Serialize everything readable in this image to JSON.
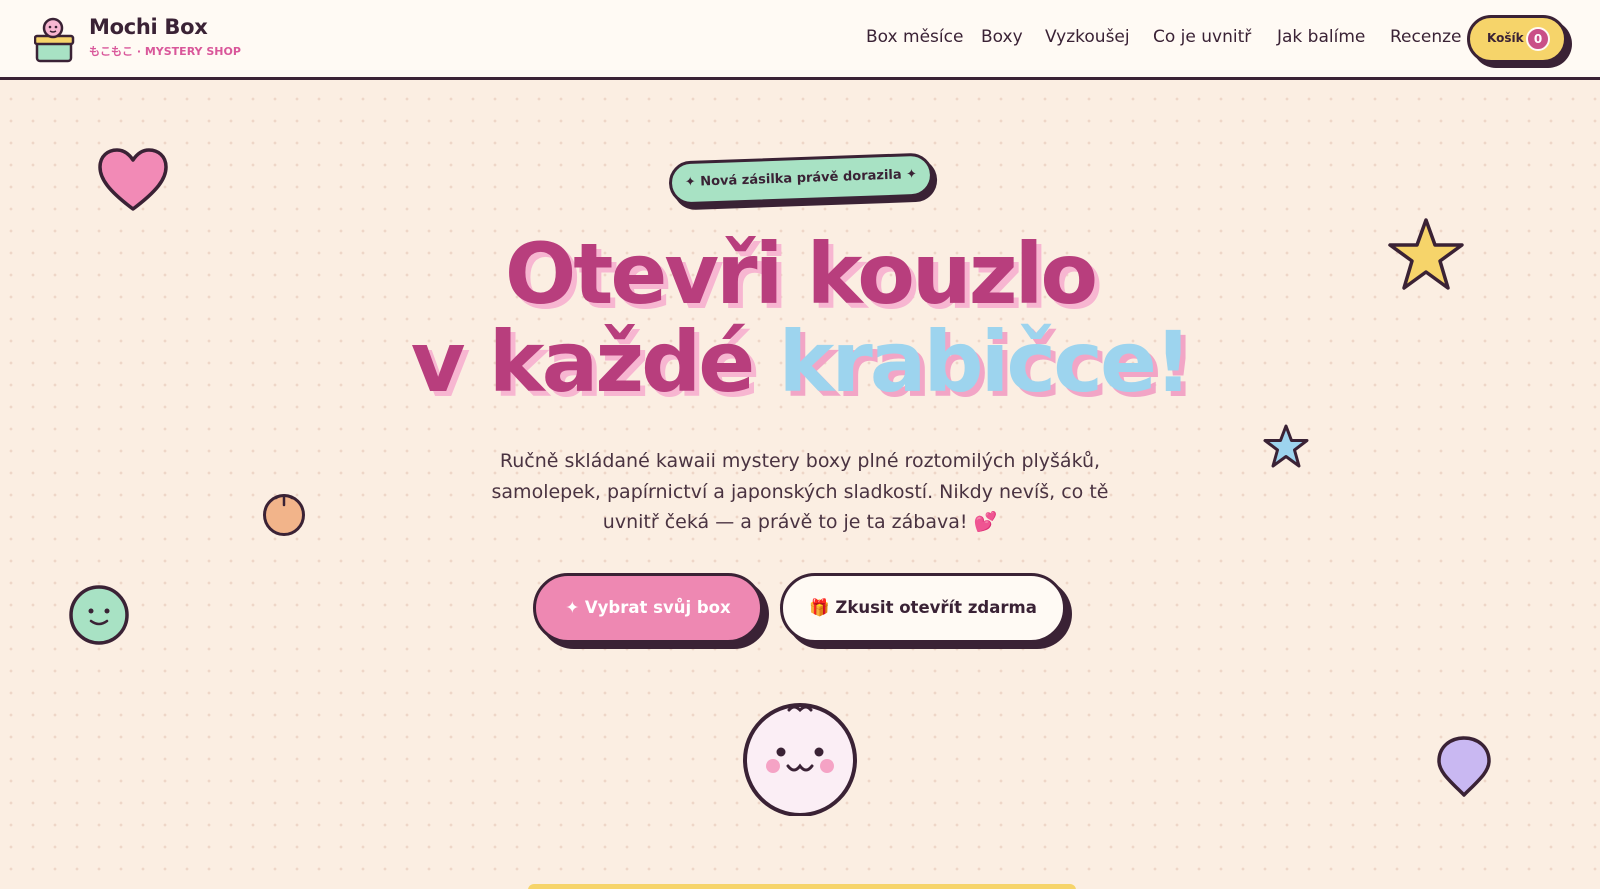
{
  "brand": {
    "name": "Mochi Box",
    "tagline": "もこもこ · MYSTERY SHOP"
  },
  "nav": {
    "items": [
      {
        "label": "Box měsíce"
      },
      {
        "label": "Boxy"
      },
      {
        "label": "Vyzkoušej"
      },
      {
        "label": "Co je uvnitř"
      },
      {
        "label": "Jak balíme"
      },
      {
        "label": "Recenze"
      }
    ],
    "cart": {
      "label": "Košík",
      "count": "0"
    }
  },
  "hero": {
    "badge": "✦ Nová zásilka právě dorazila ✦",
    "headline_line1": "Otevři kouzlo",
    "headline_line2_prefix": "v každé ",
    "headline_line2_accent": "krabičce!",
    "description": "Ručně skládané kawaii mystery boxy plné roztomilých plyšáků, samolepek, papírnictví a japonských sladkostí. Nikdy nevíš, co tě uvnitř čeká — a právě to je ta zábava! 💕",
    "primary_cta": "✦ Vybrat svůj box",
    "secondary_cta": "🎁 Zkusit otevřít zdarma"
  },
  "colors": {
    "background": "#fbeee2",
    "header_bg": "#fffaf4",
    "ink": "#3a2235",
    "headline": "#b83e7d",
    "headline_accent": "#9dd4ee",
    "pink": "#ee88b2",
    "mint": "#a8e2c4",
    "yellow": "#f6d46a",
    "lavender": "#c9b8f2",
    "peach": "#f2b48a"
  },
  "decorations": [
    "heart-icon",
    "star-icon",
    "blue-star-icon",
    "peach-icon",
    "smiley-icon",
    "mochi-mascot-icon",
    "balloon-icon"
  ]
}
